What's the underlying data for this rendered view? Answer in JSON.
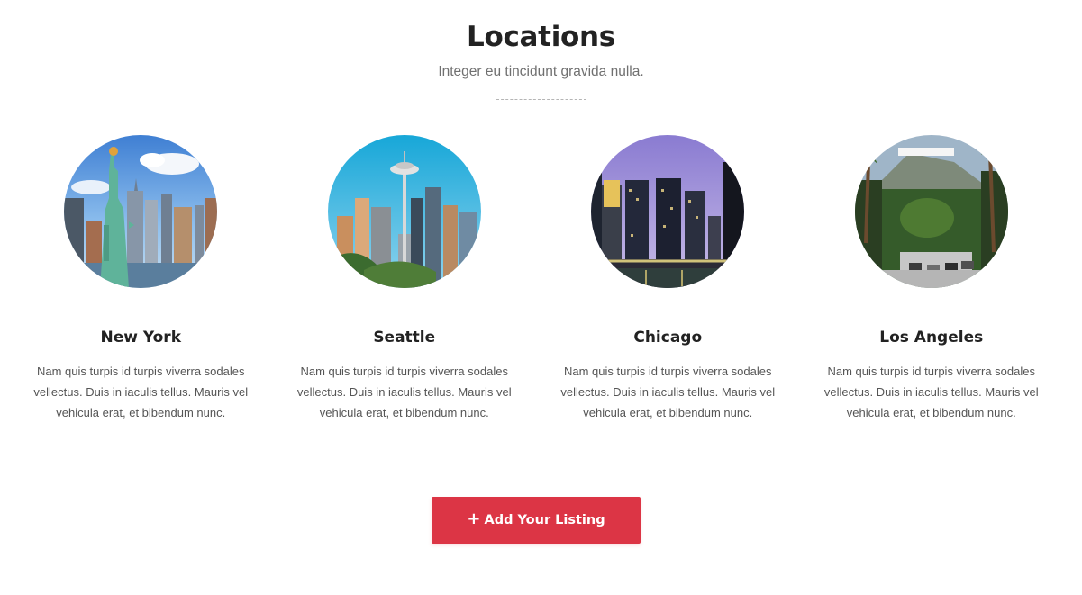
{
  "header": {
    "title": "Locations",
    "subtitle": "Integer eu tincidunt gravida nulla."
  },
  "locations": [
    {
      "name": "New York",
      "description": "Nam quis turpis id turpis viverra sodales vellectus. Duis in iaculis tellus. Mauris vel vehicula erat, et bibendum nunc."
    },
    {
      "name": "Seattle",
      "description": "Nam quis turpis id turpis viverra sodales vellectus. Duis in iaculis tellus. Mauris vel vehicula erat, et bibendum nunc."
    },
    {
      "name": "Chicago",
      "description": "Nam quis turpis id turpis viverra sodales vellectus. Duis in iaculis tellus. Mauris vel vehicula erat, et bibendum nunc."
    },
    {
      "name": "Los Angeles",
      "description": "Nam quis turpis id turpis viverra sodales vellectus. Duis in iaculis tellus. Mauris vel vehicula erat, et bibendum nunc."
    }
  ],
  "cta": {
    "icon": "plus-icon",
    "label": "Add Your Listing",
    "color": "#dc3545"
  },
  "colors": {
    "accent": "#dc3545",
    "text": "#222222",
    "muted": "#707070"
  }
}
